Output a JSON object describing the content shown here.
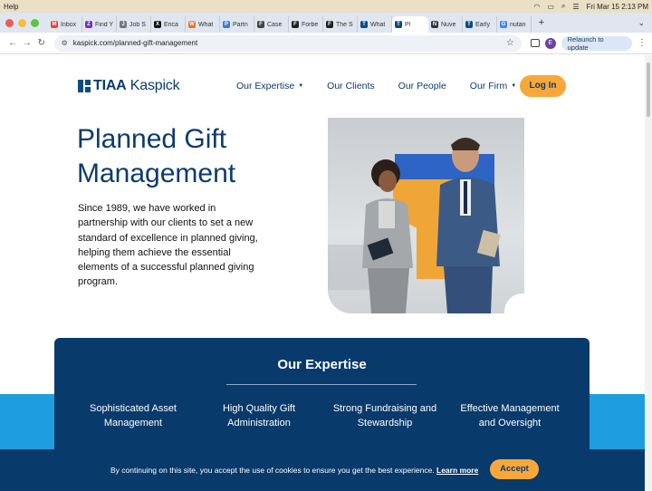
{
  "menubar": {
    "app_menu": "Help",
    "clock": "Fri Mar 15  2:13 PM"
  },
  "tabs": [
    {
      "label": "Inbox",
      "icon": "gmail-icon",
      "color": "#ea4335",
      "glyph": "M"
    },
    {
      "label": "Find Y",
      "icon": "purple-z-icon",
      "color": "#7b2fbf",
      "glyph": "Z"
    },
    {
      "label": "Job S",
      "icon": "job-icon",
      "color": "#777777",
      "glyph": "J"
    },
    {
      "label": "Erica",
      "icon": "x-icon",
      "color": "#111111",
      "glyph": "X"
    },
    {
      "label": "What",
      "icon": "page-icon",
      "color": "#e8742a",
      "glyph": "W"
    },
    {
      "label": "Partn",
      "icon": "page-icon",
      "color": "#3b7bd6",
      "glyph": "P"
    },
    {
      "label": "Case",
      "icon": "ftc-icon",
      "color": "#444444",
      "glyph": "F"
    },
    {
      "label": "Forbe",
      "icon": "forbes-icon",
      "color": "#222222",
      "glyph": "F"
    },
    {
      "label": "The S",
      "icon": "forbes-icon",
      "color": "#222222",
      "glyph": "F"
    },
    {
      "label": "What",
      "icon": "tiaa-icon",
      "color": "#0b4c85",
      "glyph": "T"
    },
    {
      "label": "Pl",
      "icon": "tiaa-icon",
      "color": "#0b4c85",
      "glyph": "T",
      "active": true
    },
    {
      "label": "Nuve",
      "icon": "nuveen-icon",
      "color": "#333333",
      "glyph": "N"
    },
    {
      "label": "Early",
      "icon": "tiaa-icon",
      "color": "#0b4c85",
      "glyph": "T"
    },
    {
      "label": "nutan",
      "icon": "google-icon",
      "color": "#4285f4",
      "glyph": "G"
    }
  ],
  "address": {
    "url": "kaspick.com/planned-gift-management",
    "profile_initial": "E",
    "relaunch_label": "Relaunch to update"
  },
  "site": {
    "logo_text_bold": "TIAA",
    "logo_text_rest": " Kaspick",
    "nav": [
      {
        "label": "Our Expertise",
        "has_caret": true
      },
      {
        "label": "Our Clients",
        "has_caret": false
      },
      {
        "label": "Our People",
        "has_caret": false
      },
      {
        "label": "Our Firm",
        "has_caret": true
      }
    ],
    "login_label": "Log In"
  },
  "hero": {
    "title": "Planned Gift Management",
    "body": "Since 1989, we have worked in partnership with our clients to set a new standard of excellence in planned giving, helping them achieve the essential elements of a successful planned giving program."
  },
  "expertise": {
    "title": "Our Expertise",
    "items": [
      "Sophisticated Asset Management",
      "High Quality Gift Administration",
      "Strong Fundraising and Stewardship",
      "Effective Management and Oversight"
    ]
  },
  "cookie": {
    "text": "By continuing on this site, you accept the use of cookies to ensure you get the best experience.",
    "link": "Learn more",
    "accept_label": "Accept"
  },
  "colors": {
    "brand_navy": "#0c3b6e",
    "panel_navy": "#083a6b",
    "accent_orange": "#f8a83b",
    "stripe_blue": "#1e9ee0"
  }
}
